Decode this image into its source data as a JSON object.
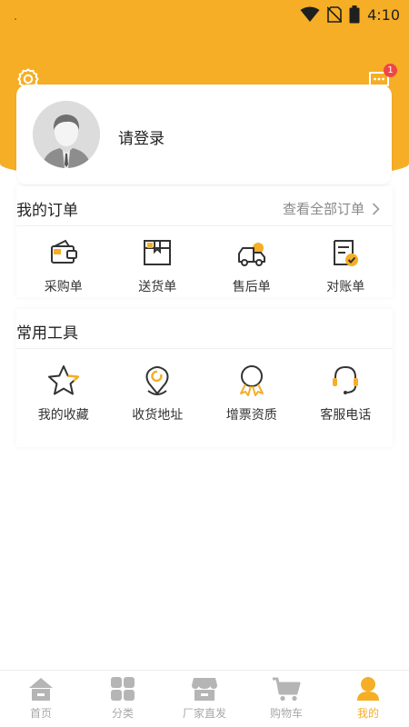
{
  "status_bar": {
    "time": "4:10"
  },
  "header": {
    "message_badge": "1"
  },
  "profile": {
    "login_label": "请登录"
  },
  "orders": {
    "title": "我的订单",
    "view_all": "查看全部订单",
    "items": [
      {
        "label": "采购单",
        "icon": "purchase-order-icon"
      },
      {
        "label": "送货单",
        "icon": "delivery-order-icon"
      },
      {
        "label": "售后单",
        "icon": "after-sales-icon"
      },
      {
        "label": "对账单",
        "icon": "statement-icon"
      }
    ]
  },
  "tools": {
    "title": "常用工具",
    "items": [
      {
        "label": "我的收藏",
        "icon": "star-icon"
      },
      {
        "label": "收货地址",
        "icon": "location-pin-icon"
      },
      {
        "label": "增票资质",
        "icon": "award-icon"
      },
      {
        "label": "客服电话",
        "icon": "headset-icon"
      }
    ]
  },
  "tabbar": {
    "active_color": "#f5ae26",
    "items": [
      {
        "label": "首页",
        "icon": "home-icon"
      },
      {
        "label": "分类",
        "icon": "category-icon"
      },
      {
        "label": "厂家直发",
        "icon": "store-icon"
      },
      {
        "label": "购物车",
        "icon": "cart-icon"
      },
      {
        "label": "我的",
        "icon": "profile-icon"
      }
    ]
  },
  "colors": {
    "brand": "#f5ae26",
    "badge": "#f04545"
  }
}
